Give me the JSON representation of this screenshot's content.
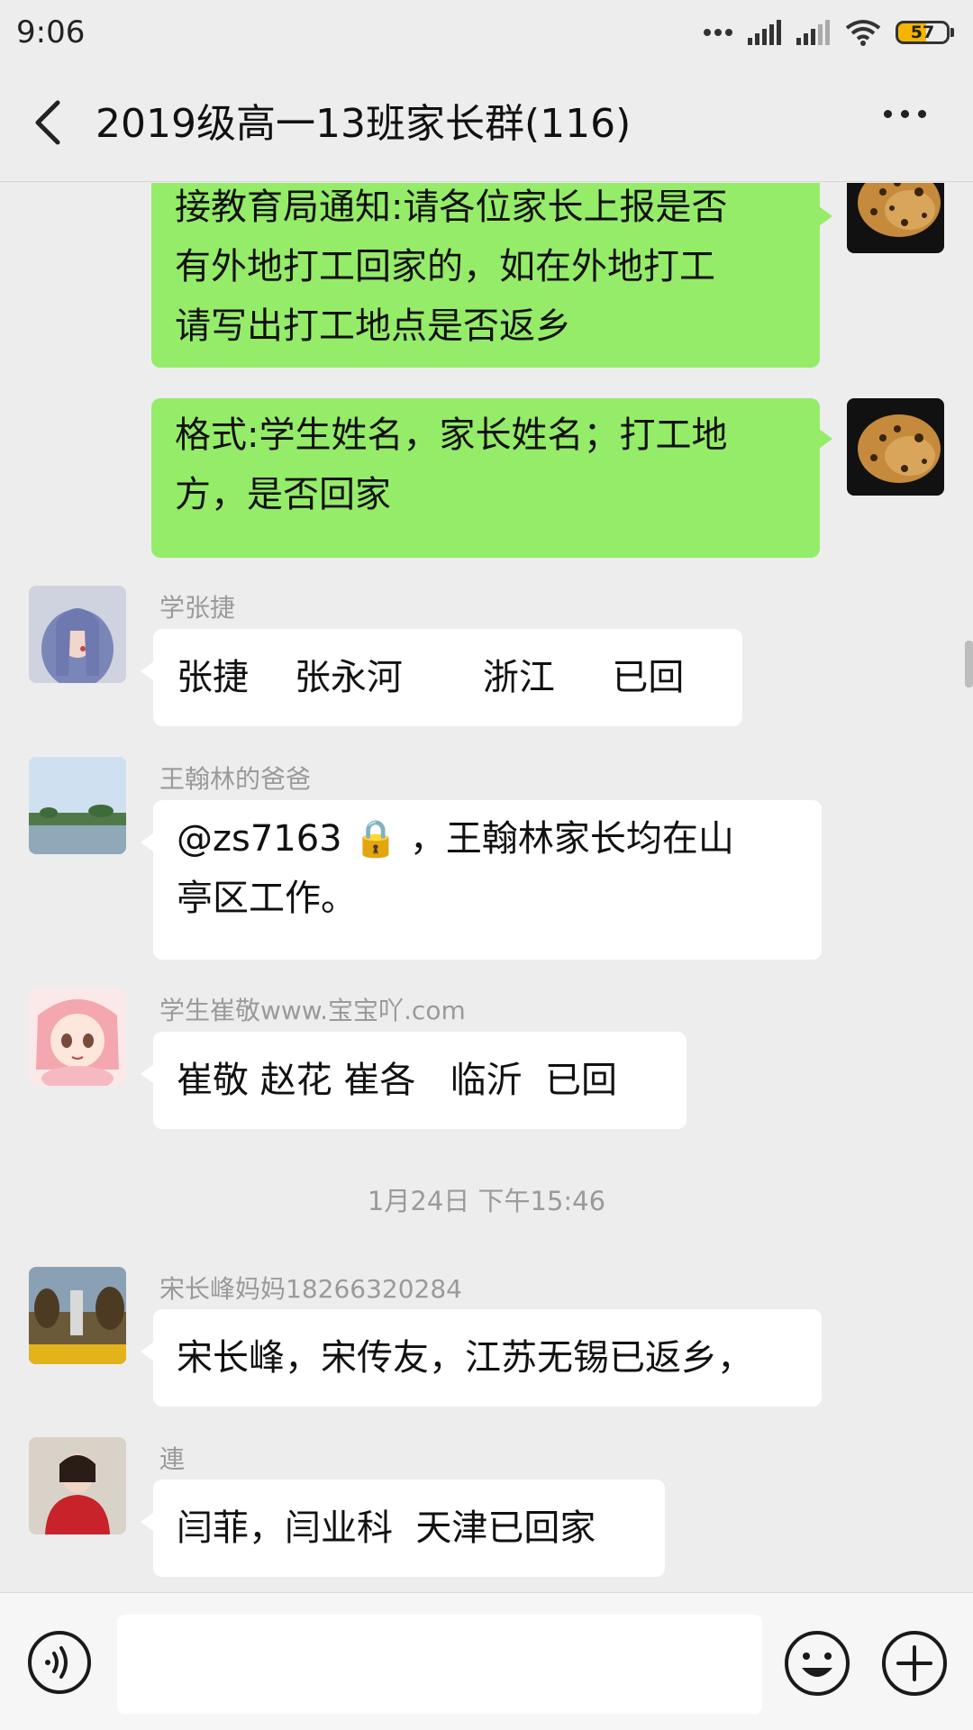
{
  "status_bar": {
    "time": "9:06",
    "battery": "57",
    "icons": [
      "dots-icon",
      "signal-icon",
      "signal-icon",
      "wifi-icon",
      "battery-icon"
    ]
  },
  "header": {
    "back_icon": "chevron-left-icon",
    "title": "2019级高一13班家长群(116)",
    "more_icon": "more-horizontal-icon"
  },
  "messages": [
    {
      "direction": "out",
      "text": "接教育局通知:请各位家长上报是否\n有外地打工回家的，如在外地打工\n请写出打工地点是否返乡"
    },
    {
      "direction": "out",
      "text": "格式:学生姓名，家长姓名；打工地\n方，是否回家"
    },
    {
      "direction": "in",
      "sender": "学张捷",
      "text": "张捷    张永河       浙江     已回"
    },
    {
      "direction": "in",
      "sender": "王翰林的爸爸",
      "text": "@zs7163 🔒 ，王翰林家长均在山\n亭区工作。"
    },
    {
      "direction": "in",
      "sender": "学生崔敬www.宝宝吖.com",
      "text": "崔敬 赵花 崔各   临沂  已回"
    },
    {
      "type": "time",
      "text": "1月24日 下午15:46"
    },
    {
      "direction": "in",
      "sender": "宋长峰妈妈18266320284",
      "text": "宋长峰，宋传友，江苏无锡已返乡，"
    },
    {
      "direction": "in",
      "sender": "連",
      "text": "闫菲，闫业科  天津已回家"
    }
  ],
  "input_bar": {
    "voice_icon": "voice-icon",
    "input_value": "",
    "emoji_icon": "emoji-icon",
    "plus_icon": "plus-circle-icon"
  },
  "colors": {
    "outgoing_bubble": "#95ec69",
    "incoming_bubble": "#ffffff",
    "background": "#ededed"
  }
}
